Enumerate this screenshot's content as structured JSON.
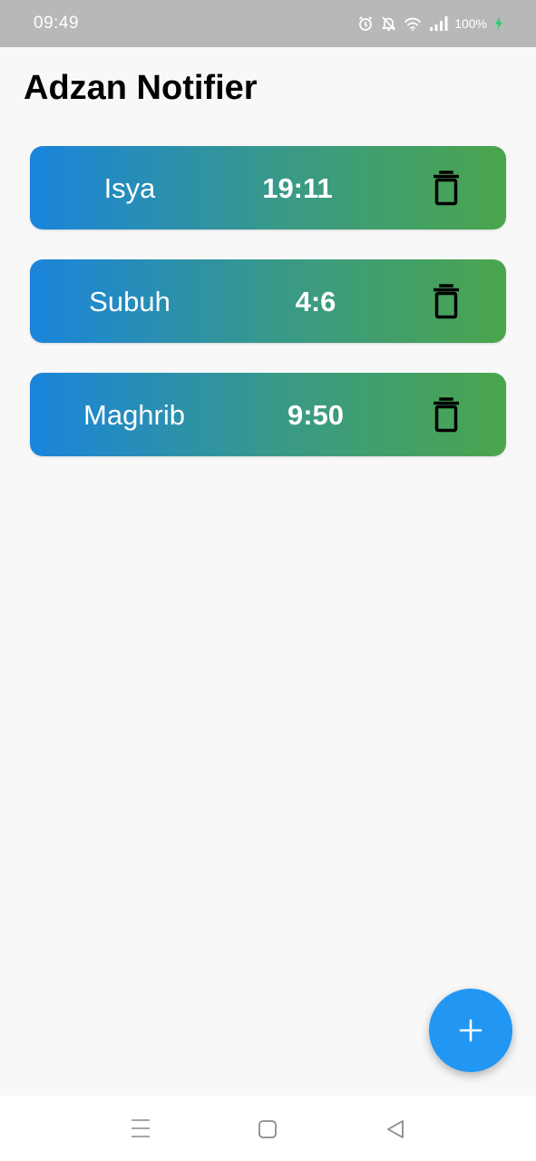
{
  "status_bar": {
    "time": "09:49",
    "battery": "100%",
    "icons": [
      "alarm-icon",
      "bell-off-icon",
      "wifi-icon",
      "signal-icon",
      "charging-icon"
    ]
  },
  "app": {
    "title": "Adzan Notifier"
  },
  "alarms": [
    {
      "name": "Isya",
      "time": "19:11"
    },
    {
      "name": "Subuh",
      "time": "4:6"
    },
    {
      "name": "Maghrib",
      "time": "9:50"
    }
  ],
  "colors": {
    "card_gradient_start": "#1a84dc",
    "card_gradient_end": "#4aa54c",
    "fab": "#2196f3",
    "status_bar": "#b8b8b8",
    "charging": "#2ecc71"
  },
  "fab": {
    "icon": "plus-icon"
  },
  "navigation": {
    "buttons": [
      "menu-icon",
      "home-icon",
      "back-icon"
    ]
  }
}
